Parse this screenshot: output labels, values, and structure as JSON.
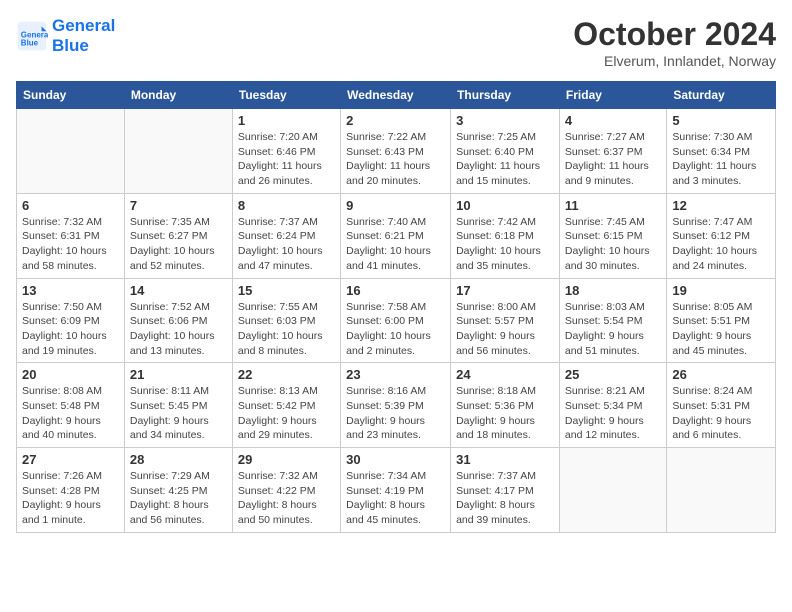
{
  "logo": {
    "line1": "General",
    "line2": "Blue"
  },
  "title": "October 2024",
  "subtitle": "Elverum, Innlandet, Norway",
  "days_of_week": [
    "Sunday",
    "Monday",
    "Tuesday",
    "Wednesday",
    "Thursday",
    "Friday",
    "Saturday"
  ],
  "weeks": [
    [
      {
        "day": "",
        "details": ""
      },
      {
        "day": "",
        "details": ""
      },
      {
        "day": "1",
        "sunrise": "Sunrise: 7:20 AM",
        "sunset": "Sunset: 6:46 PM",
        "daylight": "Daylight: 11 hours and 26 minutes."
      },
      {
        "day": "2",
        "sunrise": "Sunrise: 7:22 AM",
        "sunset": "Sunset: 6:43 PM",
        "daylight": "Daylight: 11 hours and 20 minutes."
      },
      {
        "day": "3",
        "sunrise": "Sunrise: 7:25 AM",
        "sunset": "Sunset: 6:40 PM",
        "daylight": "Daylight: 11 hours and 15 minutes."
      },
      {
        "day": "4",
        "sunrise": "Sunrise: 7:27 AM",
        "sunset": "Sunset: 6:37 PM",
        "daylight": "Daylight: 11 hours and 9 minutes."
      },
      {
        "day": "5",
        "sunrise": "Sunrise: 7:30 AM",
        "sunset": "Sunset: 6:34 PM",
        "daylight": "Daylight: 11 hours and 3 minutes."
      }
    ],
    [
      {
        "day": "6",
        "sunrise": "Sunrise: 7:32 AM",
        "sunset": "Sunset: 6:31 PM",
        "daylight": "Daylight: 10 hours and 58 minutes."
      },
      {
        "day": "7",
        "sunrise": "Sunrise: 7:35 AM",
        "sunset": "Sunset: 6:27 PM",
        "daylight": "Daylight: 10 hours and 52 minutes."
      },
      {
        "day": "8",
        "sunrise": "Sunrise: 7:37 AM",
        "sunset": "Sunset: 6:24 PM",
        "daylight": "Daylight: 10 hours and 47 minutes."
      },
      {
        "day": "9",
        "sunrise": "Sunrise: 7:40 AM",
        "sunset": "Sunset: 6:21 PM",
        "daylight": "Daylight: 10 hours and 41 minutes."
      },
      {
        "day": "10",
        "sunrise": "Sunrise: 7:42 AM",
        "sunset": "Sunset: 6:18 PM",
        "daylight": "Daylight: 10 hours and 35 minutes."
      },
      {
        "day": "11",
        "sunrise": "Sunrise: 7:45 AM",
        "sunset": "Sunset: 6:15 PM",
        "daylight": "Daylight: 10 hours and 30 minutes."
      },
      {
        "day": "12",
        "sunrise": "Sunrise: 7:47 AM",
        "sunset": "Sunset: 6:12 PM",
        "daylight": "Daylight: 10 hours and 24 minutes."
      }
    ],
    [
      {
        "day": "13",
        "sunrise": "Sunrise: 7:50 AM",
        "sunset": "Sunset: 6:09 PM",
        "daylight": "Daylight: 10 hours and 19 minutes."
      },
      {
        "day": "14",
        "sunrise": "Sunrise: 7:52 AM",
        "sunset": "Sunset: 6:06 PM",
        "daylight": "Daylight: 10 hours and 13 minutes."
      },
      {
        "day": "15",
        "sunrise": "Sunrise: 7:55 AM",
        "sunset": "Sunset: 6:03 PM",
        "daylight": "Daylight: 10 hours and 8 minutes."
      },
      {
        "day": "16",
        "sunrise": "Sunrise: 7:58 AM",
        "sunset": "Sunset: 6:00 PM",
        "daylight": "Daylight: 10 hours and 2 minutes."
      },
      {
        "day": "17",
        "sunrise": "Sunrise: 8:00 AM",
        "sunset": "Sunset: 5:57 PM",
        "daylight": "Daylight: 9 hours and 56 minutes."
      },
      {
        "day": "18",
        "sunrise": "Sunrise: 8:03 AM",
        "sunset": "Sunset: 5:54 PM",
        "daylight": "Daylight: 9 hours and 51 minutes."
      },
      {
        "day": "19",
        "sunrise": "Sunrise: 8:05 AM",
        "sunset": "Sunset: 5:51 PM",
        "daylight": "Daylight: 9 hours and 45 minutes."
      }
    ],
    [
      {
        "day": "20",
        "sunrise": "Sunrise: 8:08 AM",
        "sunset": "Sunset: 5:48 PM",
        "daylight": "Daylight: 9 hours and 40 minutes."
      },
      {
        "day": "21",
        "sunrise": "Sunrise: 8:11 AM",
        "sunset": "Sunset: 5:45 PM",
        "daylight": "Daylight: 9 hours and 34 minutes."
      },
      {
        "day": "22",
        "sunrise": "Sunrise: 8:13 AM",
        "sunset": "Sunset: 5:42 PM",
        "daylight": "Daylight: 9 hours and 29 minutes."
      },
      {
        "day": "23",
        "sunrise": "Sunrise: 8:16 AM",
        "sunset": "Sunset: 5:39 PM",
        "daylight": "Daylight: 9 hours and 23 minutes."
      },
      {
        "day": "24",
        "sunrise": "Sunrise: 8:18 AM",
        "sunset": "Sunset: 5:36 PM",
        "daylight": "Daylight: 9 hours and 18 minutes."
      },
      {
        "day": "25",
        "sunrise": "Sunrise: 8:21 AM",
        "sunset": "Sunset: 5:34 PM",
        "daylight": "Daylight: 9 hours and 12 minutes."
      },
      {
        "day": "26",
        "sunrise": "Sunrise: 8:24 AM",
        "sunset": "Sunset: 5:31 PM",
        "daylight": "Daylight: 9 hours and 6 minutes."
      }
    ],
    [
      {
        "day": "27",
        "sunrise": "Sunrise: 7:26 AM",
        "sunset": "Sunset: 4:28 PM",
        "daylight": "Daylight: 9 hours and 1 minute."
      },
      {
        "day": "28",
        "sunrise": "Sunrise: 7:29 AM",
        "sunset": "Sunset: 4:25 PM",
        "daylight": "Daylight: 8 hours and 56 minutes."
      },
      {
        "day": "29",
        "sunrise": "Sunrise: 7:32 AM",
        "sunset": "Sunset: 4:22 PM",
        "daylight": "Daylight: 8 hours and 50 minutes."
      },
      {
        "day": "30",
        "sunrise": "Sunrise: 7:34 AM",
        "sunset": "Sunset: 4:19 PM",
        "daylight": "Daylight: 8 hours and 45 minutes."
      },
      {
        "day": "31",
        "sunrise": "Sunrise: 7:37 AM",
        "sunset": "Sunset: 4:17 PM",
        "daylight": "Daylight: 8 hours and 39 minutes."
      },
      {
        "day": "",
        "details": ""
      },
      {
        "day": "",
        "details": ""
      }
    ]
  ],
  "accent_color": "#2b579a"
}
